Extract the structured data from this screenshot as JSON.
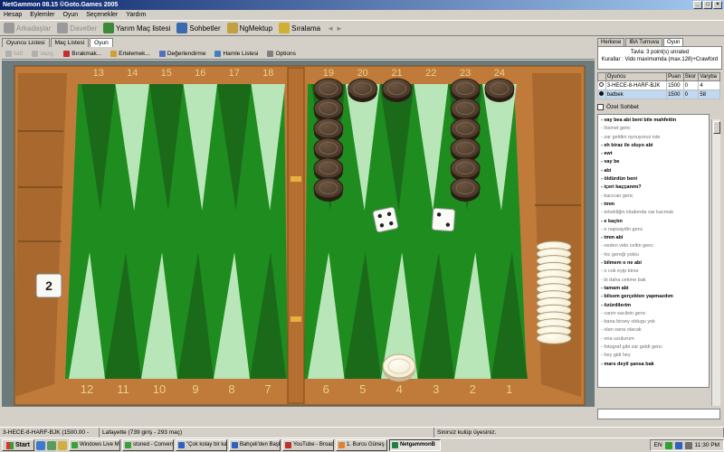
{
  "window": {
    "title": "NetGammon 08.15 ©Goto.Games 2005",
    "minimize": "_",
    "maximize": "□",
    "close": "×"
  },
  "menu": [
    "Hesap",
    "Eylemler",
    "Oyun",
    "Seçenekler",
    "Yardım"
  ],
  "toolbar": [
    {
      "label": "Arkadaşlar",
      "icon": "people-icon",
      "color": "#9a9a9a",
      "disabled": true
    },
    {
      "label": "Davetler",
      "icon": "invite-icon",
      "color": "#9a9a9a",
      "disabled": true
    },
    {
      "label": "Yarım Maç listesi",
      "icon": "half-match-icon",
      "color": "#3a8a3a",
      "disabled": false
    },
    {
      "label": "Sohbetler",
      "icon": "chat-icon",
      "color": "#3a6ab0",
      "disabled": false
    },
    {
      "label": "NgMektup",
      "icon": "mail-icon",
      "color": "#c0a040",
      "disabled": false
    },
    {
      "label": "Sıralama",
      "icon": "ranking-icon",
      "color": "#d0b030",
      "disabled": false
    }
  ],
  "main_tabs": [
    {
      "label": "Oyuncu Listesi",
      "active": false
    },
    {
      "label": "Maç Listesi",
      "active": false
    },
    {
      "label": "Oyun",
      "active": true
    }
  ],
  "game_toolbar": [
    {
      "label": "İstif",
      "disabled": true,
      "color": "#b0b0b0"
    },
    {
      "label": "Vazg.",
      "disabled": true,
      "color": "#b0b0b0"
    },
    {
      "label": "Bırakmak...",
      "disabled": false,
      "color": "#c03030"
    },
    {
      "label": "Ertelemek...",
      "disabled": false,
      "color": "#d0a030"
    },
    {
      "label": "Değerlendirme",
      "disabled": false,
      "color": "#5070c0"
    },
    {
      "label": "Hamle Listesi",
      "disabled": false,
      "color": "#4080c0"
    },
    {
      "label": "Options",
      "disabled": false,
      "color": "#808080"
    }
  ],
  "board": {
    "top_numbers": [
      "13",
      "14",
      "15",
      "16",
      "17",
      "18",
      "19",
      "20",
      "21",
      "22",
      "23",
      "24"
    ],
    "bottom_numbers": [
      "12",
      "11",
      "10",
      "9",
      "8",
      "7",
      "6",
      "5",
      "4",
      "3",
      "2",
      "1"
    ],
    "colors": {
      "frame": "#c07a3a",
      "felt": "#1e8c1e",
      "point_dark": "#1a6a1a",
      "point_light": "#b8e6b8",
      "white_checker": "#f4ecd2",
      "dark_checker": "#4a3828",
      "number": "#e8d08a"
    },
    "dark_stacks": [
      {
        "point": 19,
        "count": 6
      },
      {
        "point": 20,
        "count": 1
      },
      {
        "point": 21,
        "count": 1
      },
      {
        "point": 23,
        "count": 6
      },
      {
        "point": 24,
        "count": 1
      }
    ],
    "white_bearoff_count": 14,
    "white_point4_count": 1,
    "cube_value": "2",
    "dice": [
      4,
      2
    ]
  },
  "right_tabs": [
    {
      "label": "Herkese",
      "active": false
    },
    {
      "label": "IBA Turnuva",
      "active": false
    },
    {
      "label": "Oyun",
      "active": true
    }
  ],
  "match": {
    "line1": "Tavla: 3 point(s) unrated",
    "line2": "Kurallar : Vido maximumda (max.128)+Crawford"
  },
  "players": {
    "headers": [
      "",
      "Oyuncu",
      "Puan",
      "Skor",
      "Varyba"
    ],
    "rows": [
      {
        "marker": "white",
        "name": "3-HECE-8-HARF-BJK",
        "rating": "1500",
        "score": "0",
        "extra": "4",
        "selected": false
      },
      {
        "marker": "black",
        "name": "batbek",
        "rating": "1500",
        "score": "0",
        "extra": "58",
        "selected": true
      }
    ]
  },
  "private_chat_label": "Özel Sohbet",
  "chat": [
    {
      "text": "- vay bea abi beni bile mahfettin",
      "me": true
    },
    {
      "text": "- lösmet genc",
      "me": false
    },
    {
      "text": "- zar geldini oynuyoruz iste",
      "me": false
    },
    {
      "text": "- eh biraz ile oluyo abi",
      "me": true
    },
    {
      "text": "- ewt",
      "me": true
    },
    {
      "text": "- vay be",
      "me": true
    },
    {
      "text": "- abi",
      "me": true
    },
    {
      "text": "- öldürdün beni",
      "me": true
    },
    {
      "text": "- içeri kaççanmı?",
      "me": true
    },
    {
      "text": "- kacıcan genc",
      "me": false
    },
    {
      "text": "- tmm",
      "me": true
    },
    {
      "text": "- erkekliğin kitabında var kacmak",
      "me": false
    },
    {
      "text": "- e kaçtın",
      "me": true
    },
    {
      "text": "- e napsaydin genc",
      "me": false
    },
    {
      "text": "- tmm abi",
      "me": true
    },
    {
      "text": "- neden vido celtin genc",
      "me": false
    },
    {
      "text": "- hic gereği yoktu",
      "me": false
    },
    {
      "text": "- bilmem o ne abi",
      "me": true
    },
    {
      "text": "- o cok eyip birse",
      "me": false
    },
    {
      "text": "- bi daha cekme bak",
      "me": false
    },
    {
      "text": "- tamam abi",
      "me": true
    },
    {
      "text": "- bilsem gerçekten yapmazdım",
      "me": true
    },
    {
      "text": "- özürdilerim",
      "me": true
    },
    {
      "text": "- canin sacilsin genc",
      "me": false
    },
    {
      "text": "- bana birsey oldugu yok",
      "me": false
    },
    {
      "text": "- olan sana olacak",
      "me": false
    },
    {
      "text": "- ona uzulurum",
      "me": false
    },
    {
      "text": "- fotograf gibi zar geldi genc",
      "me": false
    },
    {
      "text": "- hey gidi hey",
      "me": false
    },
    {
      "text": "- mars deyil şansa bak",
      "me": true
    }
  ],
  "status": [
    "3-HECE-8-HARF-BJK (1500.00 -",
    "Lafayette (739 giriş - 293 maç)",
    "Sinirsiz kulüp üyesiniz."
  ],
  "taskbar": {
    "start": "Start",
    "items": [
      {
        "label": "Windows Live Messenger",
        "color": "#3aa03a",
        "active": false
      },
      {
        "label": "stoned - Conversation",
        "color": "#3aa03a",
        "active": false
      },
      {
        "label": "\"Çok kolay bir karar değil...",
        "color": "#3060c0",
        "active": false
      },
      {
        "label": "Bahçeli'den Başbakan'a ...",
        "color": "#3060c0",
        "active": false
      },
      {
        "label": "YouTube - Broadcast You...",
        "color": "#c03030",
        "active": false
      },
      {
        "label": "1. Burcu Güneş - Sahilde...",
        "color": "#e08030",
        "active": false
      },
      {
        "label": "NetgammonB",
        "color": "#208040",
        "active": true
      }
    ],
    "lang": "EN",
    "clock": "11:30 PM"
  }
}
